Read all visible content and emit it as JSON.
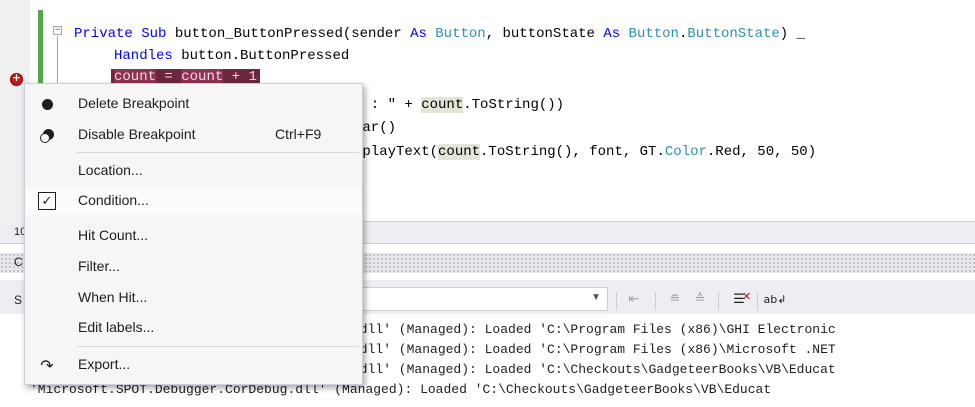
{
  "editor": {
    "line1": {
      "kw1": "Private Sub",
      "name": " button_ButtonPressed(sender ",
      "kw2": "As",
      "sp1": " ",
      "type1": "Button",
      "mid": ", buttonState ",
      "kw3": "As",
      "sp2": " ",
      "type2": "Button",
      "dot": ".",
      "type3": "ButtonState",
      "tail": ") _"
    },
    "line2": {
      "kw": "Handles",
      "rest": " button.ButtonPressed"
    },
    "breakpoint_line": {
      "tok1": "count",
      "op1": " = ",
      "tok2": "count",
      "op2": " + 1"
    },
    "line4": {
      "pre": "e : \" + ",
      "ref": "count",
      "post": ".ToString())"
    },
    "line5": {
      "text": "ear()"
    },
    "line6": {
      "pre": "splayText(",
      "ref": "count",
      "mid": ".ToString(), font, GT.",
      "type": "Color",
      "post": ".Red, 50, 50)"
    }
  },
  "zoom_fragment": "10",
  "output_title_fragment": "C",
  "show_output_fragment": "S",
  "output_lines": [
    ".dll' (Managed): Loaded 'C:\\Program Files (x86)\\GHI Electronic",
    ".dll' (Managed): Loaded 'C:\\Program Files (x86)\\Microsoft .NET",
    ".dll' (Managed): Loaded 'C:\\Checkouts\\GadgeteerBooks\\VB\\Educat",
    "'Microsoft.SPOT.Debugger.CorDebug.dll' (Managed): Loaded 'C:\\Checkouts\\GadgeteerBooks\\VB\\Educat"
  ],
  "context_menu": {
    "delete_breakpoint": "Delete Breakpoint",
    "disable_breakpoint": "Disable Breakpoint",
    "disable_shortcut": "Ctrl+F9",
    "location": "Location...",
    "condition": "Condition...",
    "condition_check": "✓",
    "hit_count": "Hit Count...",
    "filter": "Filter...",
    "when_hit": "When Hit...",
    "edit_labels": "Edit labels...",
    "export": "Export..."
  },
  "icons": {
    "clear_all": "clear-all-icon",
    "word_wrap": "word-wrap-icon",
    "toggle_wrap_glyph": "ab↲"
  },
  "colors": {
    "breakpoint_red": "#c4161c",
    "breakpoint_line_bg": "#6c2640",
    "keyword_blue": "#0000ff",
    "type_teal": "#2b91af",
    "change_bar_green": "#57a64a"
  }
}
